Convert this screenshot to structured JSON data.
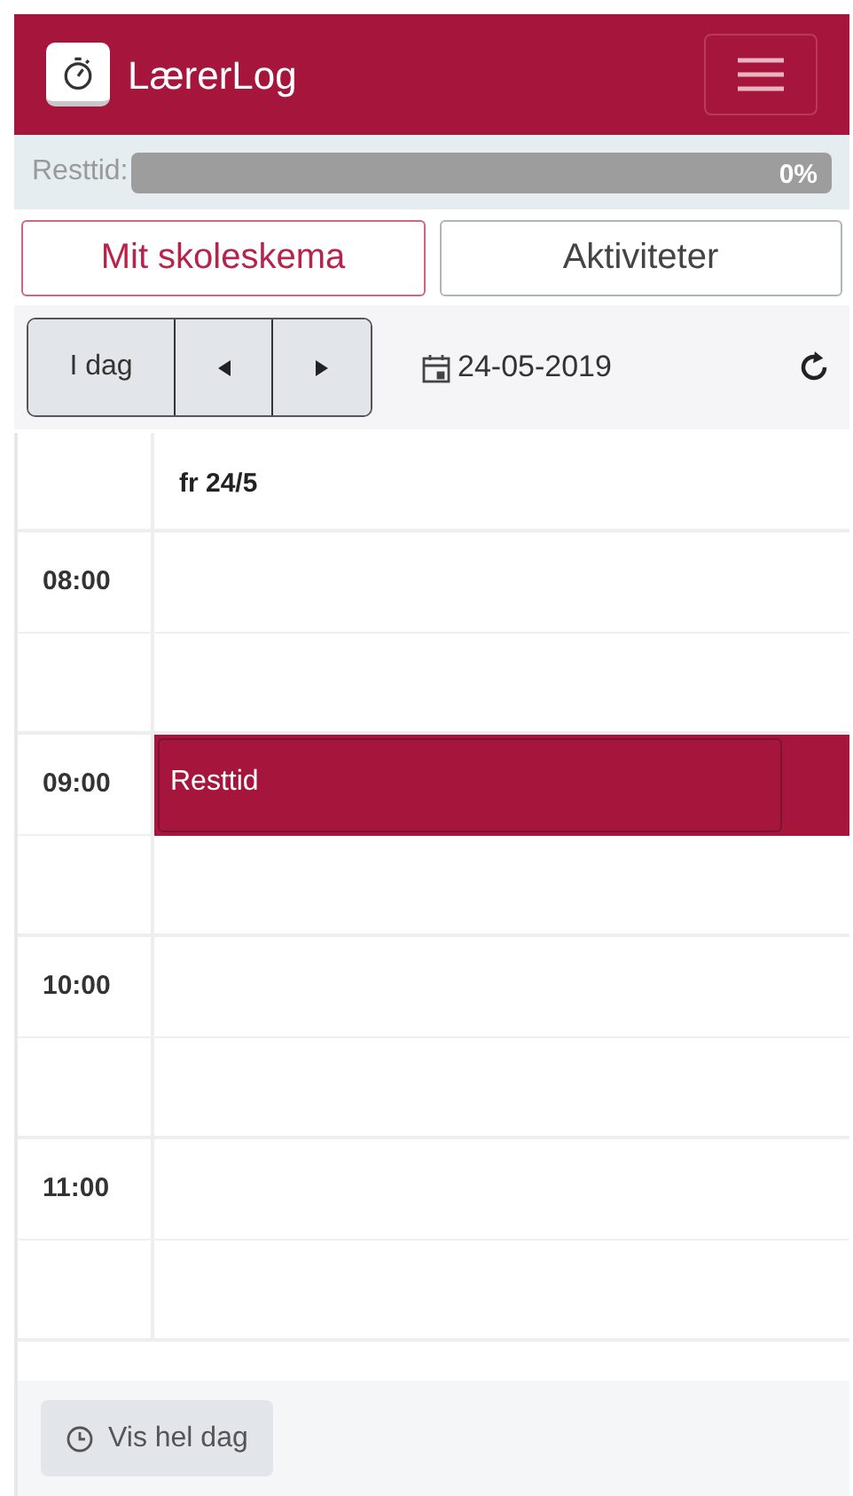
{
  "app": {
    "title": "LærerLog"
  },
  "remaining": {
    "label": "Resttid:",
    "level": 0,
    "reading": "0%"
  },
  "tabs": [
    {
      "label": "Mit skoleskema",
      "selected": true
    },
    {
      "label": "Aktiviteter",
      "selected": false
    }
  ],
  "toolbar": {
    "today": "I dag",
    "date": "24-05-2019"
  },
  "calendar": {
    "day": "fr 24/5",
    "hours": [
      {
        "time": "08:00"
      },
      {
        "time": "09:00",
        "events": [
          {
            "title": "Resttid"
          }
        ]
      },
      {
        "time": "10:00"
      },
      {
        "time": "11:00"
      }
    ]
  },
  "footer": {
    "button": "Vis hel dag"
  }
}
